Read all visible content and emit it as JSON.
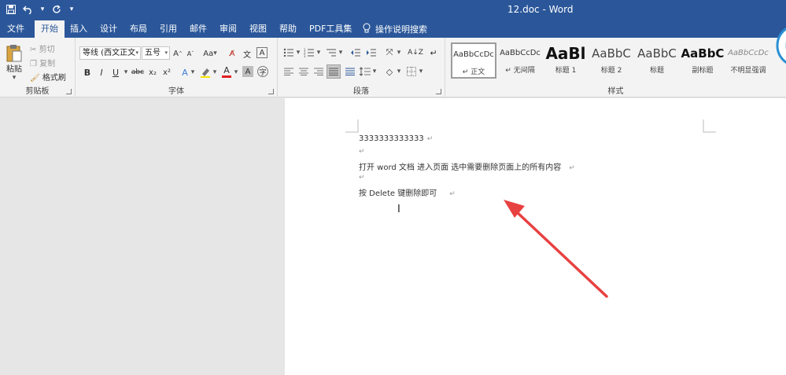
{
  "window": {
    "title": "12.doc - Word"
  },
  "qat": {
    "save": "save-icon",
    "undo": "undo-icon",
    "redo": "redo-icon",
    "customize": "▾"
  },
  "tabs": [
    "文件",
    "开始",
    "插入",
    "设计",
    "布局",
    "引用",
    "邮件",
    "审阅",
    "视图",
    "帮助",
    "PDF工具集"
  ],
  "tellme": "操作说明搜索",
  "clipboard": {
    "paste": "粘贴",
    "cut": "剪切",
    "copy": "复制",
    "format_painter": "格式刷",
    "label": "剪贴板"
  },
  "font": {
    "name": "等线 (西文正文",
    "size": "五号",
    "grow": "A",
    "shrink": "A",
    "case": "Aa",
    "bold": "B",
    "italic": "I",
    "underline": "U",
    "strike": "abc",
    "sub": "x₂",
    "sup": "x²",
    "label": "字体"
  },
  "paragraph": {
    "label": "段落"
  },
  "styles": {
    "label": "样式",
    "items": [
      {
        "preview": "AaBbCcDc",
        "name": "↵ 正文"
      },
      {
        "preview": "AaBbCcDc",
        "name": "↵ 无间隔"
      },
      {
        "preview": "AaBl",
        "name": "标题 1"
      },
      {
        "preview": "AaBbC",
        "name": "标题 2"
      },
      {
        "preview": "AaBbC",
        "name": "标题"
      },
      {
        "preview": "AaBbC",
        "name": "副标题"
      },
      {
        "preview": "AaBbCcDc",
        "name": "不明显强调"
      }
    ]
  },
  "document": {
    "lines": [
      "3333333333333",
      "",
      "打开 word 文档   进入页面   选中需要删除页面上的所有内容",
      "",
      "按 Delete 键删除即可"
    ],
    "pilcrow": "↵"
  },
  "colors": {
    "titlebar": "#2b579a",
    "ribbon": "#f3f3f3",
    "workspace": "#e6e6e6",
    "arrow": "#e84141"
  }
}
